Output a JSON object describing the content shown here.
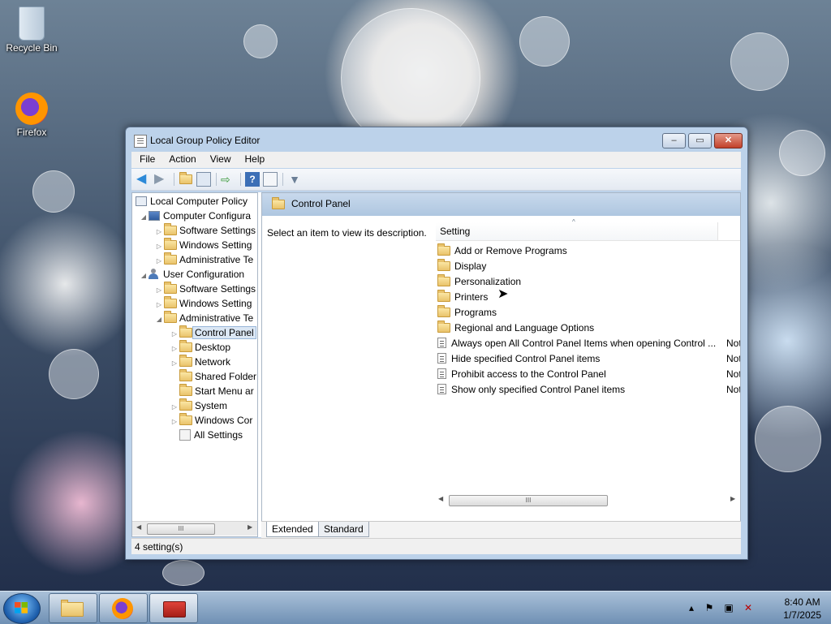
{
  "desktop": {
    "icons": [
      {
        "label": "Recycle Bin",
        "icon": "recycle-bin-icon"
      },
      {
        "label": "Firefox",
        "icon": "firefox-icon"
      }
    ]
  },
  "window": {
    "title": "Local Group Policy Editor",
    "buttons": {
      "minimize": "–",
      "maximize": "▭",
      "close": "✕"
    }
  },
  "menu": [
    "File",
    "Action",
    "View",
    "Help"
  ],
  "tree": {
    "root": "Local Computer Policy",
    "items": [
      "Computer Configura",
      "Software Settings",
      "Windows Setting",
      "Administrative Te",
      "User Configuration",
      "Software Settings",
      "Windows Setting",
      "Administrative Te",
      "Control Panel",
      "Desktop",
      "Network",
      "Shared Folder",
      "Start Menu ar",
      "System",
      "Windows Cor",
      "All Settings"
    ],
    "scroll_thumb": "III"
  },
  "right": {
    "header_title": "Control Panel",
    "description": "Select an item to view its description.",
    "column_setting": "Setting",
    "sort_glyph": "^",
    "rows": [
      {
        "name": "Add or Remove Programs",
        "type": "folder",
        "state": ""
      },
      {
        "name": "Display",
        "type": "folder",
        "state": ""
      },
      {
        "name": "Personalization",
        "type": "folder",
        "state": ""
      },
      {
        "name": "Printers",
        "type": "folder",
        "state": ""
      },
      {
        "name": "Programs",
        "type": "folder",
        "state": ""
      },
      {
        "name": "Regional and Language Options",
        "type": "folder",
        "state": ""
      },
      {
        "name": "Always open All Control Panel Items when opening Control ...",
        "type": "policy",
        "state": "Not"
      },
      {
        "name": "Hide specified Control Panel items",
        "type": "policy",
        "state": "Not"
      },
      {
        "name": "Prohibit access to the Control Panel",
        "type": "policy",
        "state": "Not"
      },
      {
        "name": "Show only specified Control Panel items",
        "type": "policy",
        "state": "Not"
      }
    ],
    "scroll_thumb": "III"
  },
  "tabs": {
    "extended": "Extended",
    "standard": "Standard"
  },
  "status": "4 setting(s)",
  "taskbar": {
    "time": "8:40 AM",
    "date": "1/7/2025"
  }
}
